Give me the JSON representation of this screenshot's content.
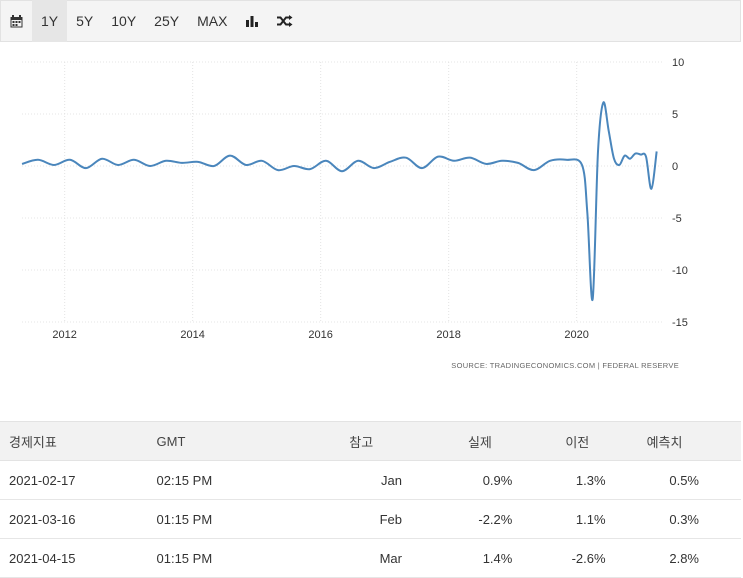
{
  "toolbar": {
    "calendar_icon": "calendar-icon",
    "ranges": [
      "1Y",
      "5Y",
      "10Y",
      "25Y",
      "MAX"
    ],
    "active_range": "1Y",
    "bar_chart_icon": "bar-chart-icon",
    "shuffle_icon": "shuffle-icon"
  },
  "chart_data": {
    "type": "line",
    "title": "",
    "xlabel": "",
    "ylabel": "",
    "x_ticks": [
      "2012",
      "2014",
      "2016",
      "2018",
      "2020"
    ],
    "y_ticks": [
      10,
      5,
      0,
      -5,
      -10,
      -15
    ],
    "xlim": [
      "2011-05",
      "2021-05"
    ],
    "ylim": [
      -15,
      10
    ],
    "grid": true,
    "y_axis_side": "right",
    "color": "#4a86bc",
    "series": [
      {
        "x": [
          "2011-05",
          "2011-08",
          "2011-11",
          "2012-02",
          "2012-05",
          "2012-08",
          "2012-11",
          "2013-02",
          "2013-05",
          "2013-08",
          "2013-11",
          "2014-02",
          "2014-05",
          "2014-08",
          "2014-11",
          "2015-02",
          "2015-05",
          "2015-08",
          "2015-11",
          "2016-02",
          "2016-05",
          "2016-08",
          "2016-11",
          "2017-02",
          "2017-05",
          "2017-08",
          "2017-11",
          "2018-02",
          "2018-05",
          "2018-08",
          "2018-11",
          "2019-02",
          "2019-05",
          "2019-08",
          "2019-11",
          "2020-02",
          "2020-03",
          "2020-04",
          "2020-05",
          "2020-06",
          "2020-07",
          "2020-08",
          "2020-09",
          "2020-10",
          "2020-11",
          "2020-12",
          "2021-01",
          "2021-02",
          "2021-03",
          "2021-04"
        ],
        "y": [
          0.2,
          0.6,
          0.1,
          0.6,
          -0.2,
          0.7,
          0.1,
          0.6,
          0.0,
          0.5,
          0.3,
          0.4,
          0.0,
          1.0,
          0.1,
          0.5,
          -0.4,
          0.0,
          -0.3,
          0.5,
          -0.5,
          0.5,
          -0.2,
          0.4,
          0.8,
          -0.2,
          0.9,
          0.5,
          0.8,
          0.2,
          0.5,
          0.3,
          -0.4,
          0.5,
          0.6,
          0.1,
          -4.5,
          -12.8,
          1.4,
          6.1,
          3.4,
          0.7,
          0.1,
          1.0,
          0.7,
          1.2,
          1.1,
          0.9,
          -2.2,
          1.4
        ]
      }
    ]
  },
  "source": "SOURCE: TRADINGECONOMICS.COM  |  FEDERAL RESERVE",
  "table": {
    "headers": [
      "경제지표",
      "GMT",
      "참고",
      "실제",
      "이전",
      "예측치"
    ],
    "rows": [
      [
        "2021-02-17",
        "02:15 PM",
        "Jan",
        "0.9%",
        "1.3%",
        "0.5%"
      ],
      [
        "2021-03-16",
        "01:15 PM",
        "Feb",
        "-2.2%",
        "1.1%",
        "0.3%"
      ],
      [
        "2021-04-15",
        "01:15 PM",
        "Mar",
        "1.4%",
        "-2.6%",
        "2.8%"
      ]
    ]
  }
}
